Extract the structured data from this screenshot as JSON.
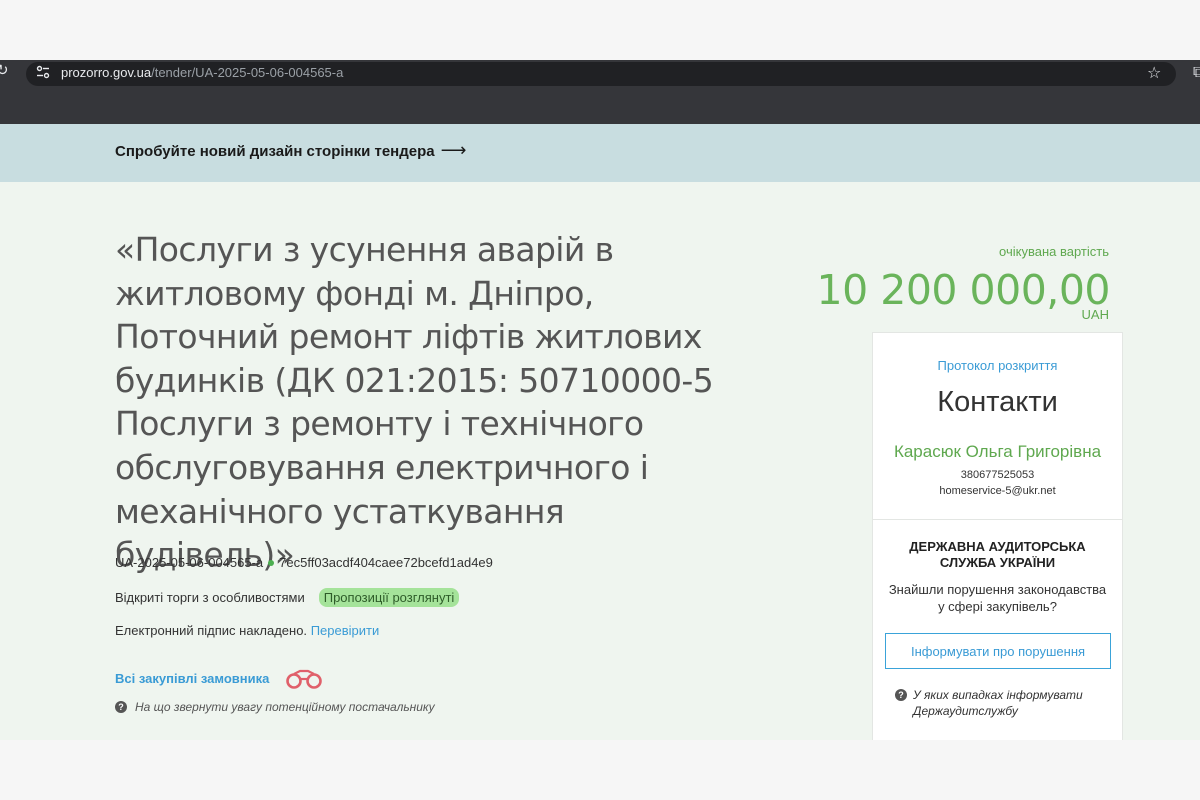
{
  "browser": {
    "url_host": "prozorro.gov.ua",
    "url_path": "/tender/UA-2025-05-06-004565-a"
  },
  "banner": {
    "label": "Спробуйте новий дизайн сторінки тендера"
  },
  "tender": {
    "title": "«Послуги з усунення аварій в житловому фонді м. Дніпро, Поточний ремонт ліфтів житлових будинків (ДК 021:2015: 50710000-5 Послуги з ремонту і технічного обслуговування електричного і механічного устаткування будівель)»",
    "tender_id": "UA-2025-05-06-004565-a",
    "hash": "7ec5ff03acdf404caee72bcefd1ad4e9",
    "procedure": "Відкриті торги з особливостями",
    "status": "Пропозиції розглянуті",
    "signature_text": "Електронний підпис накладено.",
    "verify_link": "Перевірити",
    "all_purchases_link": "Всі закупівлі замовника",
    "hint": "На що звернути увагу потенційному постачальнику"
  },
  "value": {
    "label": "очікувана вартість",
    "amount": "10 200 000,00",
    "currency": "UAH"
  },
  "sidebar": {
    "protocol_link": "Протокол розкриття",
    "contacts_heading": "Контакти",
    "contact_name": "Карасюк Ольга Григорівна",
    "contact_phone": "380677525053",
    "contact_email": "homeservice-5@ukr.net",
    "audit_title": "ДЕРЖАВНА АУДИТОРСЬКА СЛУЖБА УКРАЇНИ",
    "audit_question": "Знайшли порушення законодавства у сфері закупівель?",
    "report_button": "Інформувати про порушення",
    "audit_hint": "У яких випадках інформувати Держаудитслужбу"
  },
  "icons": {
    "reload": "reload-icon",
    "site_settings": "tune-icon",
    "bookmark": "star-icon",
    "arrow": "arrow-right-icon",
    "binoculars": "binoculars-icon",
    "help": "question-circle-icon"
  },
  "colors": {
    "banner_bg": "#c8dde0",
    "page_bg": "#eff5ef",
    "accent_green": "#6ab45b",
    "link_blue": "#3a9bd5",
    "badge_green": "#a5e39a"
  }
}
